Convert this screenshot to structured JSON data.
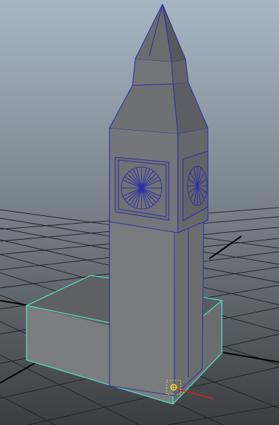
{
  "viewport": {
    "view": "perspective",
    "background_top": "#a6b4c2",
    "background_bottom": "#3d3f42",
    "grid_color": "#1a1a1a",
    "wireframe_color": "#2a2fa8",
    "selection_color": "#4de0c4",
    "pivot_color": "#f0e020",
    "x_axis_color": "#e02020"
  },
  "scene": {
    "objects": [
      {
        "name": "clock-tower",
        "type": "polygon-mesh",
        "selected": false
      },
      {
        "name": "base-block",
        "type": "polygon-mesh",
        "selected": true
      }
    ],
    "manipulator": "move-pivot-icon"
  }
}
